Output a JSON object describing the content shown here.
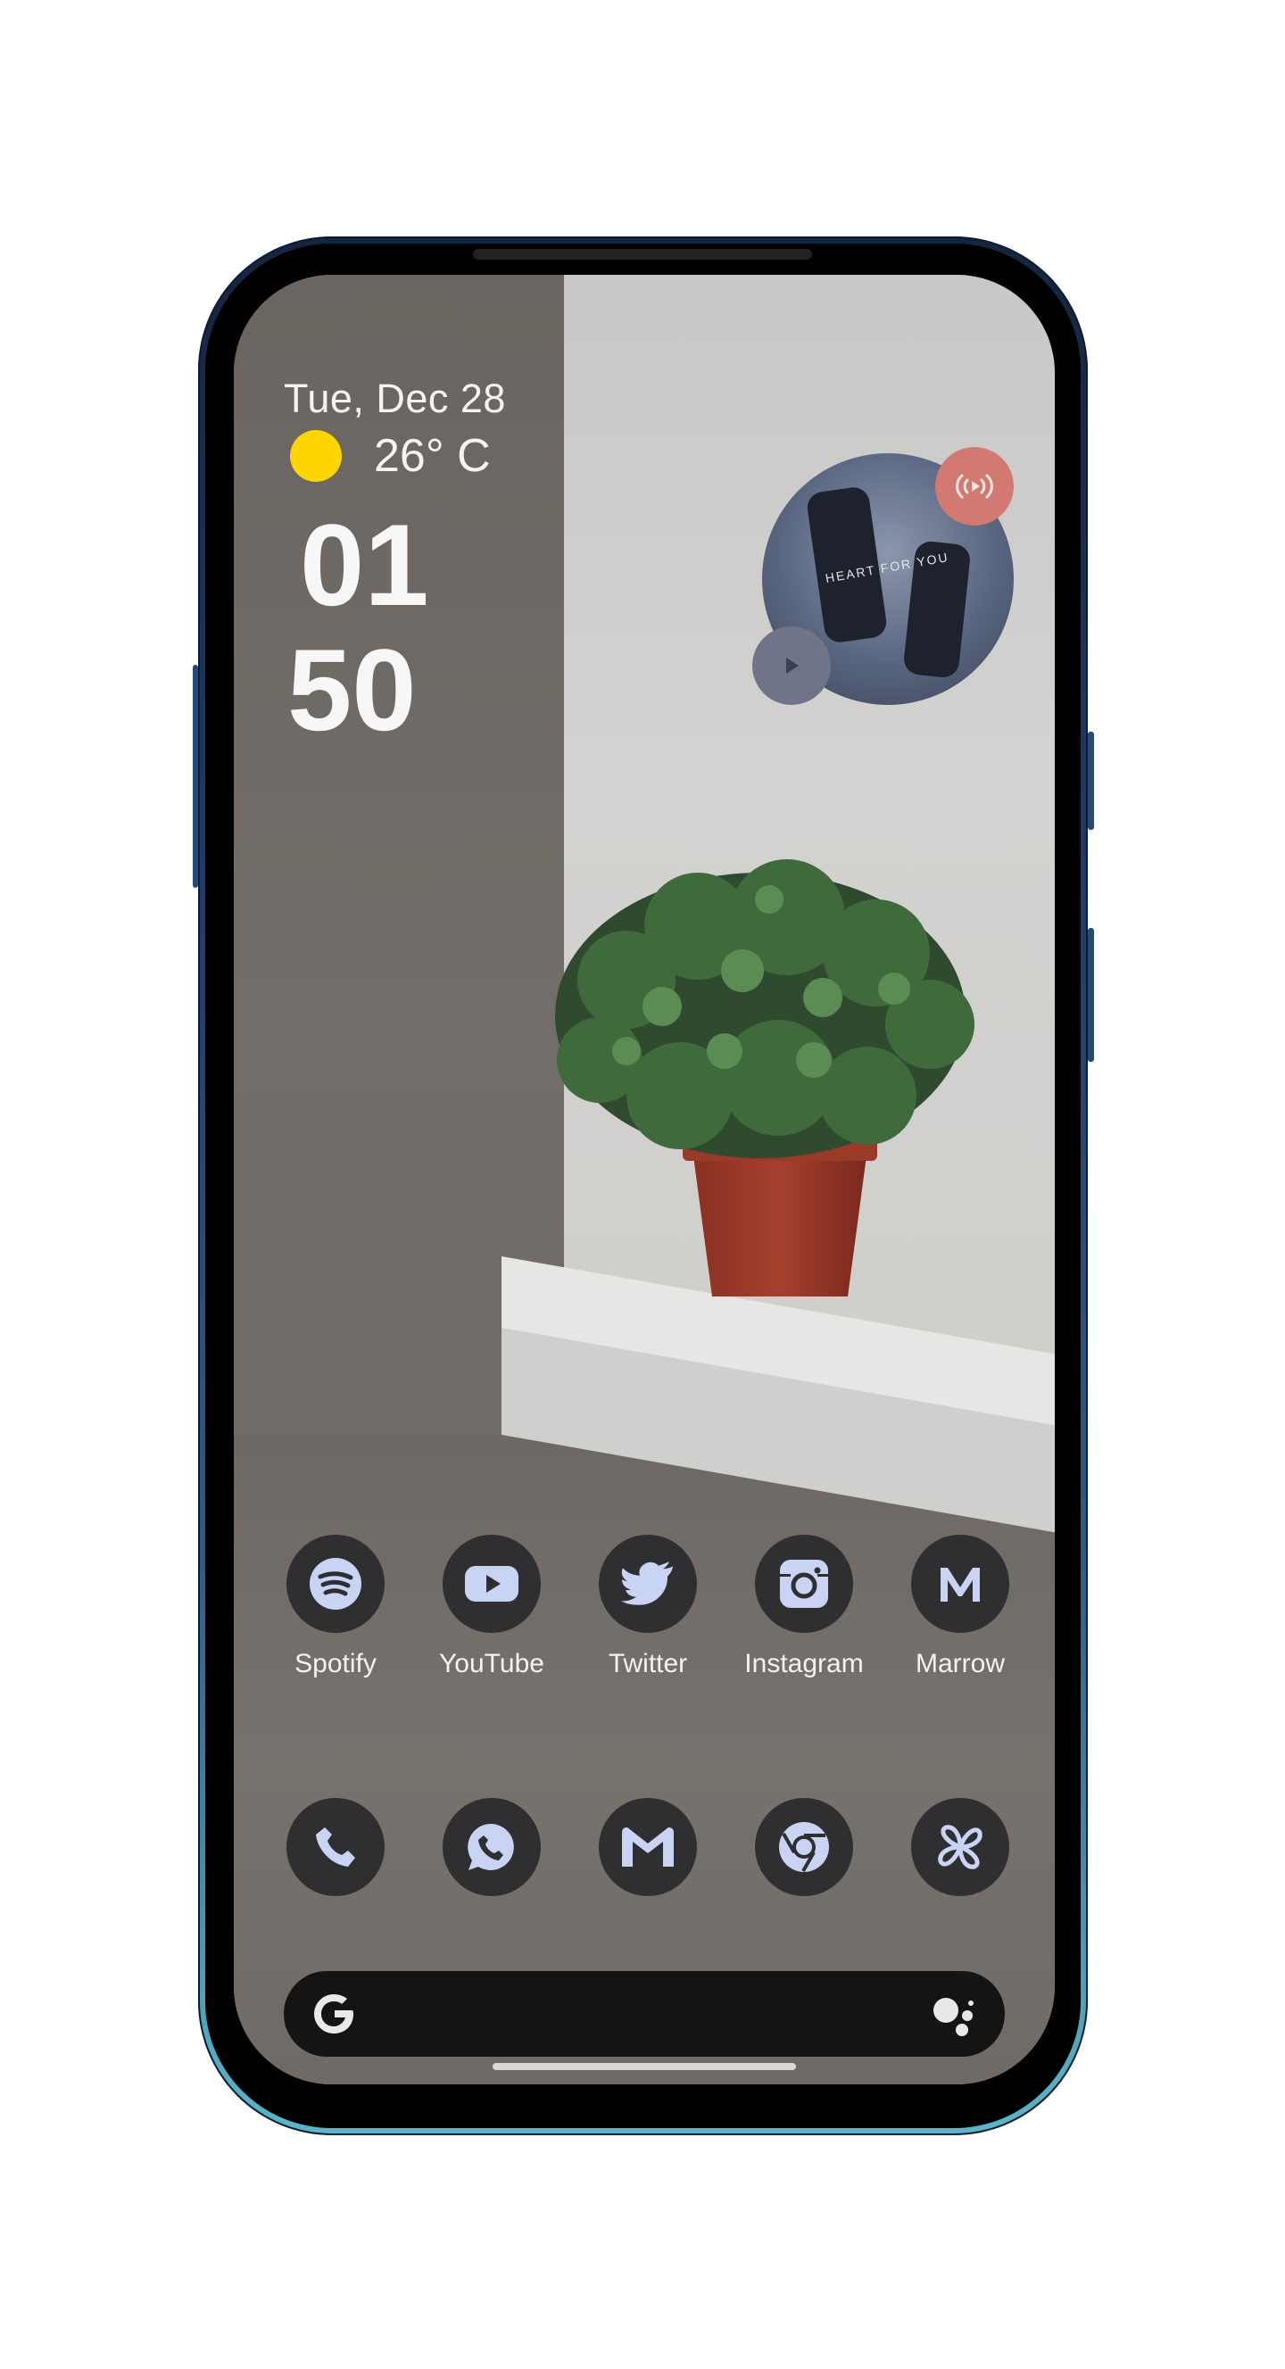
{
  "widgets": {
    "date": "Tue, Dec 28",
    "temperature": "26° C",
    "clock_hours": "01",
    "clock_minutes": "50",
    "media_caption": "HEART FOR YOU"
  },
  "apps_row1": [
    {
      "label": "Spotify",
      "icon": "spotify-icon"
    },
    {
      "label": "YouTube",
      "icon": "youtube-icon"
    },
    {
      "label": "Twitter",
      "icon": "twitter-icon"
    },
    {
      "label": "Instagram",
      "icon": "instagram-icon"
    },
    {
      "label": "Marrow",
      "icon": "marrow-icon"
    }
  ],
  "dock": [
    {
      "icon": "phone-icon"
    },
    {
      "icon": "whatsapp-icon"
    },
    {
      "icon": "gmail-icon"
    },
    {
      "icon": "chrome-icon"
    },
    {
      "icon": "pinwheel-icon"
    }
  ],
  "colors": {
    "accent_sun": "#ffd500",
    "icon_glyph": "#c9d4f5",
    "icon_bg": "#2f2f32",
    "search_bg": "#141414",
    "cast_button": "#d27a72"
  }
}
